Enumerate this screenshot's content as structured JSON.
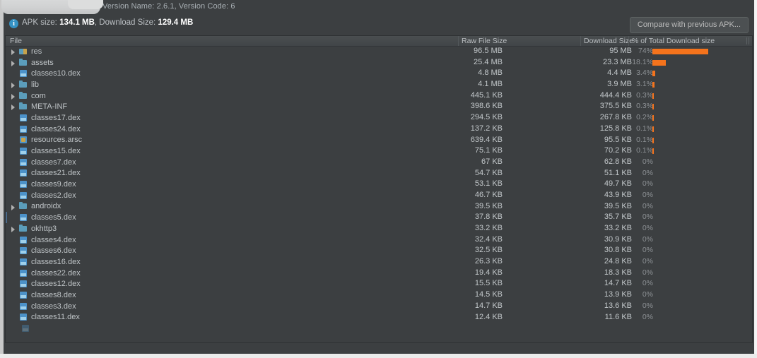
{
  "window": {
    "version_info": "Version Name: 2.6.1, Version Code: 6"
  },
  "summary": {
    "info_icon": "info-icon",
    "prefix": "APK size:",
    "apk_size": "134.1 MB",
    "middle": ", Download Size:",
    "download_size": "129.4 MB",
    "full_text": "APK size: 134.1 MB, Download Size: 129.4 MB",
    "compare_button": "Compare with previous APK..."
  },
  "table": {
    "columns": {
      "file": "File",
      "raw_file_size": "Raw File Size",
      "download_size": "Download Size",
      "percent_of_total": "% of Total Download size"
    },
    "rows": [
      {
        "name": "res",
        "icon": "folder-res-icon",
        "expandable": true,
        "raw": "96.5 MB",
        "download": "95 MB",
        "pct": "74%",
        "bar_pct": 74,
        "selected": false
      },
      {
        "name": "assets",
        "icon": "folder-icon",
        "expandable": true,
        "raw": "25.4 MB",
        "download": "23.3 MB",
        "pct": "18.1%",
        "bar_pct": 18.1,
        "selected": false
      },
      {
        "name": "classes10.dex",
        "icon": "dex-file-icon",
        "expandable": false,
        "raw": "4.8 MB",
        "download": "4.4 MB",
        "pct": "3.4%",
        "bar_pct": 3.4,
        "selected": false
      },
      {
        "name": "lib",
        "icon": "folder-icon",
        "expandable": true,
        "raw": "4.1 MB",
        "download": "3.9 MB",
        "pct": "3.1%",
        "bar_pct": 3.1,
        "selected": false
      },
      {
        "name": "com",
        "icon": "folder-icon",
        "expandable": true,
        "raw": "445.1 KB",
        "download": "444.4 KB",
        "pct": "0.3%",
        "bar_pct": 0.3,
        "selected": false
      },
      {
        "name": "META-INF",
        "icon": "folder-icon",
        "expandable": true,
        "raw": "398.6 KB",
        "download": "375.5 KB",
        "pct": "0.3%",
        "bar_pct": 0.3,
        "selected": false
      },
      {
        "name": "classes17.dex",
        "icon": "dex-file-icon",
        "expandable": false,
        "raw": "294.5 KB",
        "download": "267.8 KB",
        "pct": "0.2%",
        "bar_pct": 0.2,
        "selected": false
      },
      {
        "name": "classes24.dex",
        "icon": "dex-file-icon",
        "expandable": false,
        "raw": "137.2 KB",
        "download": "125.8 KB",
        "pct": "0.1%",
        "bar_pct": 0.1,
        "selected": false
      },
      {
        "name": "resources.arsc",
        "icon": "arsc-file-icon",
        "expandable": false,
        "raw": "639.4 KB",
        "download": "95.5 KB",
        "pct": "0.1%",
        "bar_pct": 0.1,
        "selected": false
      },
      {
        "name": "classes15.dex",
        "icon": "dex-file-icon",
        "expandable": false,
        "raw": "75.1 KB",
        "download": "70.2 KB",
        "pct": "0.1%",
        "bar_pct": 0.1,
        "selected": false
      },
      {
        "name": "classes7.dex",
        "icon": "dex-file-icon",
        "expandable": false,
        "raw": "67 KB",
        "download": "62.8 KB",
        "pct": "0%",
        "bar_pct": 0,
        "selected": false
      },
      {
        "name": "classes21.dex",
        "icon": "dex-file-icon",
        "expandable": false,
        "raw": "54.7 KB",
        "download": "51.1 KB",
        "pct": "0%",
        "bar_pct": 0,
        "selected": false
      },
      {
        "name": "classes9.dex",
        "icon": "dex-file-icon",
        "expandable": false,
        "raw": "53.1 KB",
        "download": "49.7 KB",
        "pct": "0%",
        "bar_pct": 0,
        "selected": false
      },
      {
        "name": "classes2.dex",
        "icon": "dex-file-icon",
        "expandable": false,
        "raw": "46.7 KB",
        "download": "43.9 KB",
        "pct": "0%",
        "bar_pct": 0,
        "selected": false
      },
      {
        "name": "androidx",
        "icon": "folder-icon",
        "expandable": true,
        "raw": "39.5 KB",
        "download": "39.5 KB",
        "pct": "0%",
        "bar_pct": 0,
        "selected": false
      },
      {
        "name": "classes5.dex",
        "icon": "dex-file-icon",
        "expandable": false,
        "raw": "37.8 KB",
        "download": "35.7 KB",
        "pct": "0%",
        "bar_pct": 0,
        "selected": true
      },
      {
        "name": "okhttp3",
        "icon": "folder-icon",
        "expandable": true,
        "raw": "33.2 KB",
        "download": "33.2 KB",
        "pct": "0%",
        "bar_pct": 0,
        "selected": false
      },
      {
        "name": "classes4.dex",
        "icon": "dex-file-icon",
        "expandable": false,
        "raw": "32.4 KB",
        "download": "30.9 KB",
        "pct": "0%",
        "bar_pct": 0,
        "selected": false
      },
      {
        "name": "classes6.dex",
        "icon": "dex-file-icon",
        "expandable": false,
        "raw": "32.5 KB",
        "download": "30.8 KB",
        "pct": "0%",
        "bar_pct": 0,
        "selected": false
      },
      {
        "name": "classes16.dex",
        "icon": "dex-file-icon",
        "expandable": false,
        "raw": "26.3 KB",
        "download": "24.8 KB",
        "pct": "0%",
        "bar_pct": 0,
        "selected": false
      },
      {
        "name": "classes22.dex",
        "icon": "dex-file-icon",
        "expandable": false,
        "raw": "19.4 KB",
        "download": "18.3 KB",
        "pct": "0%",
        "bar_pct": 0,
        "selected": false
      },
      {
        "name": "classes12.dex",
        "icon": "dex-file-icon",
        "expandable": false,
        "raw": "15.5 KB",
        "download": "14.7 KB",
        "pct": "0%",
        "bar_pct": 0,
        "selected": false
      },
      {
        "name": "classes8.dex",
        "icon": "dex-file-icon",
        "expandable": false,
        "raw": "14.5 KB",
        "download": "13.9 KB",
        "pct": "0%",
        "bar_pct": 0,
        "selected": false
      },
      {
        "name": "classes3.dex",
        "icon": "dex-file-icon",
        "expandable": false,
        "raw": "14.7 KB",
        "download": "13.6 KB",
        "pct": "0%",
        "bar_pct": 0,
        "selected": false
      },
      {
        "name": "classes11.dex",
        "icon": "dex-file-icon",
        "expandable": false,
        "raw": "12.4 KB",
        "download": "11.6 KB",
        "pct": "0%",
        "bar_pct": 0,
        "selected": false
      }
    ]
  },
  "colors": {
    "bar_orange": "#f4731c",
    "panel_bg": "#3c3f41",
    "info_blue": "#3592c4"
  }
}
